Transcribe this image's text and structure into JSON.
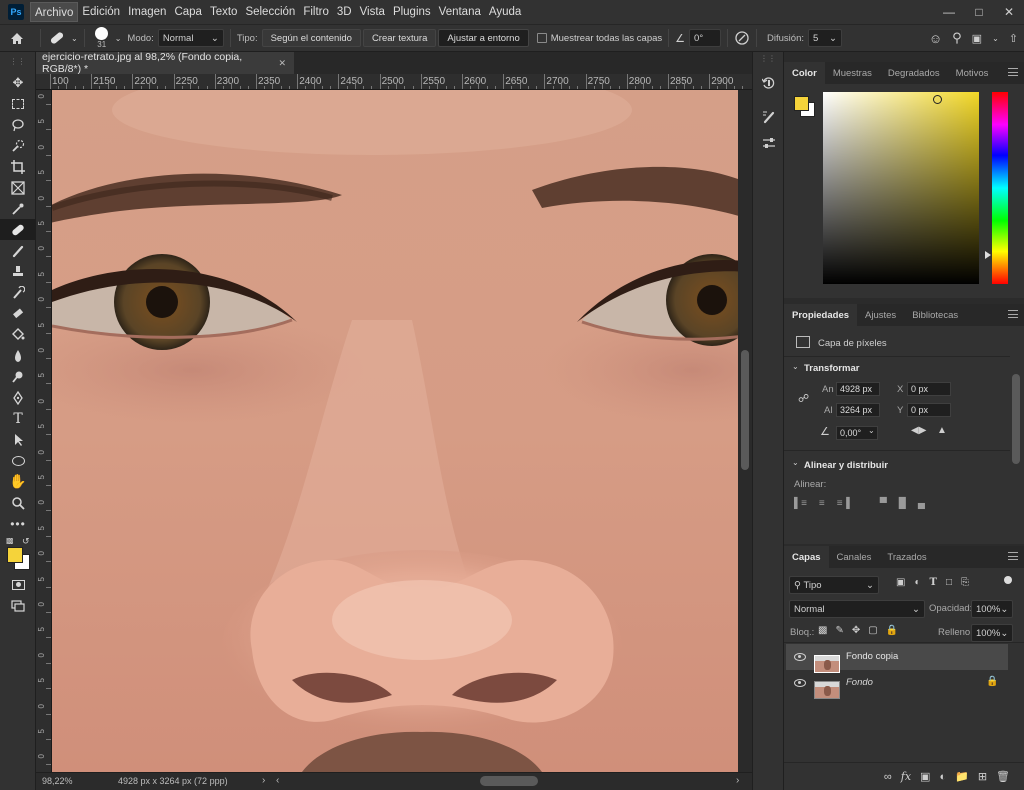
{
  "app": {
    "logo": "Ps"
  },
  "menu": [
    "Archivo",
    "Edición",
    "Imagen",
    "Capa",
    "Texto",
    "Selección",
    "Filtro",
    "3D",
    "Vista",
    "Plugins",
    "Ventana",
    "Ayuda"
  ],
  "options": {
    "brush_size": "31",
    "mode_label": "Modo:",
    "mode_value": "Normal",
    "type_label": "Tipo:",
    "type_buttons": [
      "Según el contenido",
      "Crear textura",
      "Ajustar a entorno"
    ],
    "sample_all_layers": "Muestrear todas las capas",
    "angle": "0°",
    "diffusion_label": "Difusión:",
    "diffusion_value": "5"
  },
  "document": {
    "tab_title": "ejercicio-retrato.jpg al 98,2% (Fondo copia, RGB/8*) *",
    "ruler_top": [
      "100",
      "2150",
      "2200",
      "2250",
      "2300",
      "2350",
      "2400",
      "2450",
      "2500",
      "2550",
      "2600",
      "2650",
      "2700",
      "2750",
      "2800",
      "2850",
      "2900"
    ],
    "ruler_left": [
      "0",
      "5",
      "0",
      "5",
      "0",
      "5",
      "0",
      "5",
      "0",
      "5",
      "0",
      "5",
      "0",
      "5",
      "0",
      "5",
      "0",
      "5",
      "0",
      "5",
      "0",
      "5",
      "0",
      "5",
      "0",
      "5",
      "0"
    ],
    "zoom": "98,22%",
    "dimensions": "4928 px x 3264 px (72 ppp)"
  },
  "color_panel": {
    "tabs": [
      "Color",
      "Muestras",
      "Degradados",
      "Motivos"
    ],
    "foreground": "#f5d33a",
    "background": "#ffffff",
    "hue": "#f2d726"
  },
  "properties_panel": {
    "tabs": [
      "Propiedades",
      "Ajustes",
      "Bibliotecas"
    ],
    "kind": "Capa de píxeles",
    "transform_title": "Transformar",
    "width_label": "An",
    "width_value": "4928 px",
    "height_label": "Al",
    "height_value": "3264 px",
    "x_label": "X",
    "x_value": "0 px",
    "y_label": "Y",
    "y_value": "0 px",
    "angle_value": "0,00°",
    "align_title": "Alinear y distribuir",
    "align_label": "Alinear:"
  },
  "layers_panel": {
    "tabs": [
      "Capas",
      "Canales",
      "Trazados"
    ],
    "filter_kind": "Tipo",
    "blend_mode": "Normal",
    "opacity_label": "Opacidad:",
    "opacity_value": "100%",
    "lock_label": "Bloq.:",
    "fill_label": "Relleno:",
    "fill_value": "100%",
    "layers": [
      {
        "name": "Fondo copia",
        "selected": true,
        "locked": false
      },
      {
        "name": "Fondo",
        "selected": false,
        "locked": true
      }
    ]
  }
}
